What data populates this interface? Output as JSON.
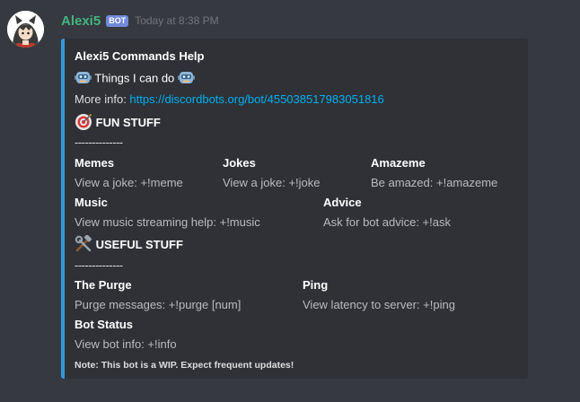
{
  "message": {
    "username": "Alexi5",
    "bot_tag": "BOT",
    "timestamp": "Today at 8:38 PM"
  },
  "embed": {
    "accent_color": "#3498db",
    "title": "Alexi5 Commands Help",
    "subtitle": "Things I can do",
    "more_info_label": "More info: ",
    "more_info_link": "https://discordbots.org/bot/455038517983051816",
    "fun_heading": "FUN STUFF",
    "fun_divider": "--------------",
    "fun_fields": [
      {
        "name": "Memes",
        "value": "View a joke: +!meme"
      },
      {
        "name": "Jokes",
        "value": "View a joke: +!joke"
      },
      {
        "name": "Amazeme",
        "value": "Be amazed: +!amazeme"
      },
      {
        "name": "Music",
        "value": "View music streaming help: +!music"
      },
      {
        "name": "Advice",
        "value": "Ask for bot advice: +!ask"
      }
    ],
    "useful_heading": "USEFUL STUFF",
    "useful_divider": "--------------",
    "useful_fields": [
      {
        "name": "The Purge",
        "value": "Purge messages: +!purge [num]"
      },
      {
        "name": "Ping",
        "value": "View latency to server: +!ping"
      },
      {
        "name": "Bot Status",
        "value": "View bot info: +!info"
      }
    ],
    "footer": "Note: This bot is a WIP. Expect frequent updates!"
  },
  "icons": {
    "avatar": "avatar-anime-girl",
    "subtitle_emoji": "robot-face-icon",
    "fun_emoji": "target-dart-icon",
    "useful_emoji": "hammer-wrench-icon"
  }
}
